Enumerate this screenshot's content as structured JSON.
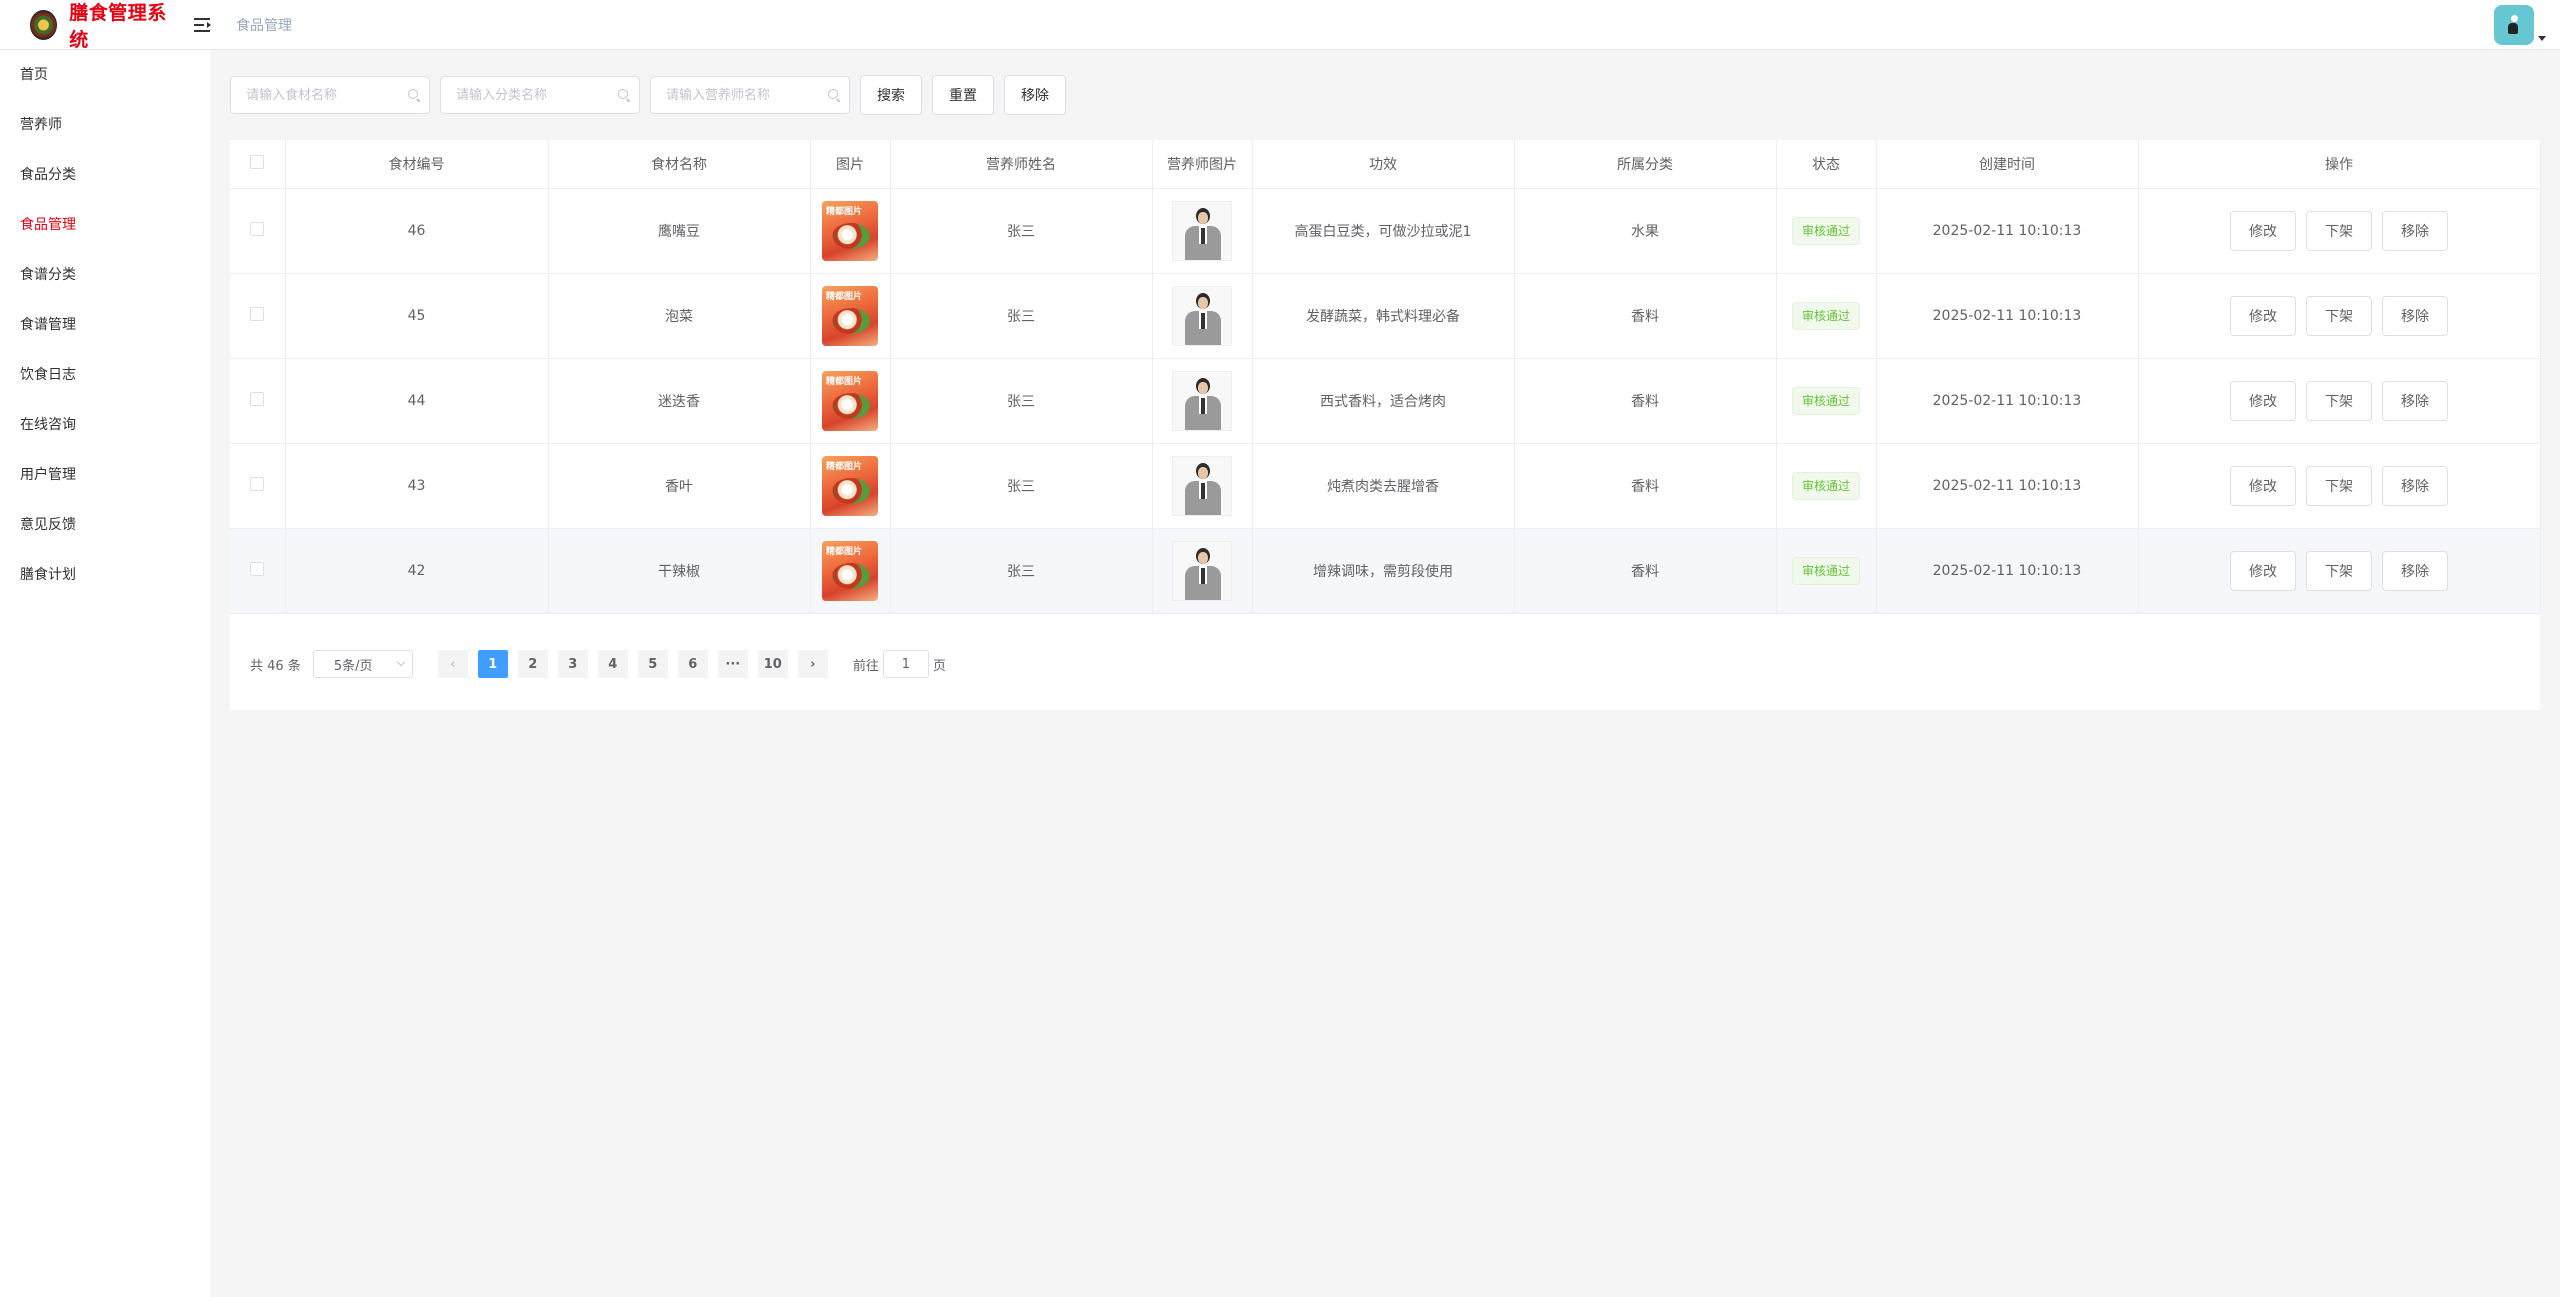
{
  "app": {
    "title": "膳食管理系统",
    "breadcrumb": "食品管理"
  },
  "sidebar": {
    "items": [
      {
        "label": "首页",
        "active": false
      },
      {
        "label": "营养师",
        "active": false
      },
      {
        "label": "食品分类",
        "active": false
      },
      {
        "label": "食品管理",
        "active": true
      },
      {
        "label": "食谱分类",
        "active": false
      },
      {
        "label": "食谱管理",
        "active": false
      },
      {
        "label": "饮食日志",
        "active": false
      },
      {
        "label": "在线咨询",
        "active": false
      },
      {
        "label": "用户管理",
        "active": false
      },
      {
        "label": "意见反馈",
        "active": false
      },
      {
        "label": "膳食计划",
        "active": false
      }
    ]
  },
  "search": {
    "food_placeholder": "请输入食材名称",
    "category_placeholder": "请输入分类名称",
    "nutritionist_placeholder": "请输入营养师名称",
    "search_label": "搜索",
    "reset_label": "重置",
    "remove_label": "移除"
  },
  "table": {
    "headers": [
      "食材编号",
      "食材名称",
      "图片",
      "营养师姓名",
      "营养师图片",
      "功效",
      "所属分类",
      "状态",
      "创建时间",
      "操作"
    ],
    "rows": [
      {
        "id": "46",
        "name": "鹰嘴豆",
        "image_banner": "精都图片",
        "nutritionist": "张三",
        "effect": "高蛋白豆类，可做沙拉或泥1",
        "category": "水果",
        "status": "审核通过",
        "created": "2025-02-11 10:10:13"
      },
      {
        "id": "45",
        "name": "泡菜",
        "image_banner": "精都图片",
        "nutritionist": "张三",
        "effect": "发酵蔬菜，韩式料理必备",
        "category": "香料",
        "status": "审核通过",
        "created": "2025-02-11 10:10:13"
      },
      {
        "id": "44",
        "name": "迷迭香",
        "image_banner": "精都图片",
        "nutritionist": "张三",
        "effect": "西式香料，适合烤肉",
        "category": "香料",
        "status": "审核通过",
        "created": "2025-02-11 10:10:13"
      },
      {
        "id": "43",
        "name": "香叶",
        "image_banner": "精都图片",
        "nutritionist": "张三",
        "effect": "炖煮肉类去腥增香",
        "category": "香料",
        "status": "审核通过",
        "created": "2025-02-11 10:10:13"
      },
      {
        "id": "42",
        "name": "干辣椒",
        "image_banner": "精都图片",
        "nutritionist": "张三",
        "effect": "增辣调味，需剪段使用",
        "category": "香料",
        "status": "审核通过",
        "created": "2025-02-11 10:10:13"
      }
    ],
    "actions": {
      "edit": "修改",
      "offline": "下架",
      "remove": "移除"
    }
  },
  "pagination": {
    "total": "共 46 条",
    "page_size": "5条/页",
    "prev": "‹",
    "next": "›",
    "pages": [
      "1",
      "2",
      "3",
      "4",
      "5",
      "6",
      "···",
      "10"
    ],
    "current_page": "1",
    "goto_label": "前往",
    "goto_value": "1",
    "page_suffix": "页"
  },
  "colors": {
    "brand": "#e60012",
    "primary": "#409eff",
    "success": "#67c23a",
    "avatar_bg": "#66c6d1"
  },
  "icons": {
    "menu_toggle": "hamburger-fold-icon",
    "search": "search-icon",
    "user": "user-avatar-icon"
  }
}
